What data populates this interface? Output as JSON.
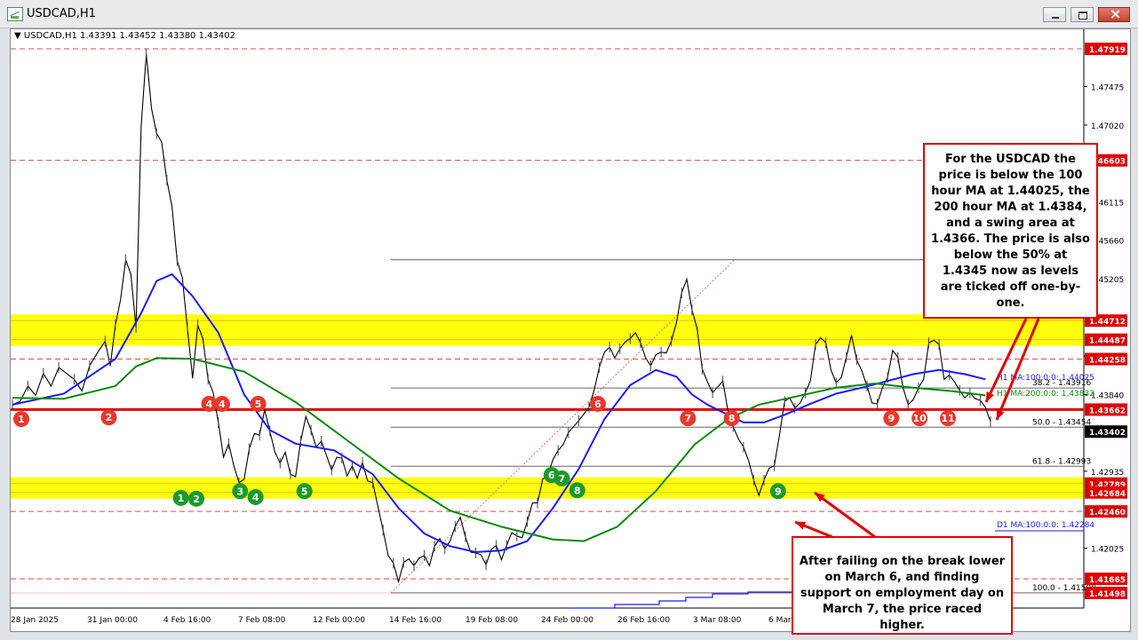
{
  "window": {
    "title": "USDCAD,H1",
    "controls": {
      "minimize": "minimize",
      "maximize": "maximize",
      "close": "close"
    }
  },
  "chart_header": {
    "symbol_line": "USDCAD,H1  1.43391 1.43452 1.43380 1.43402"
  },
  "colors": {
    "candles": "#000000",
    "ma100": "#1a1aff",
    "ma200": "#0a8a0a",
    "highlight": "#ffff00",
    "swing_line": "#e00000",
    "labels_red": "#e8382c",
    "labels_green": "#1c9a2a"
  },
  "chart_data": {
    "type": "line",
    "symbol": "USDCAD",
    "timeframe": "H1",
    "ohlc_last": {
      "open": 1.43391,
      "high": 1.43452,
      "low": 1.4338,
      "close": 1.43402
    },
    "x_axis_labels": [
      "28 Jan 2025",
      "31 Jan 00:00",
      "4 Feb 16:00",
      "7 Feb 08:00",
      "12 Feb 00:00",
      "14 Feb 16:00",
      "19 Feb 08:00",
      "24 Feb 00:00",
      "26 Feb 16:00",
      "3 Mar 08:00",
      "6 Mar"
    ],
    "y_axis_labels": [
      "1.47475",
      "1.47020",
      "1.46115",
      "1.45660",
      "1.45205",
      "1.44750",
      "1.44295",
      "1.43840",
      "1.42935",
      "1.42025"
    ],
    "y_range": [
      1.4132,
      1.4815
    ],
    "price_markers": [
      {
        "label": "1.47919",
        "value": 1.47919,
        "dashed": true
      },
      {
        "label": "1.46603",
        "value": 1.46603,
        "dashed": true
      },
      {
        "label": "1.44712",
        "value": 1.44712,
        "dashed": false
      },
      {
        "label": "1.44487",
        "value": 1.44487,
        "dashed": false
      },
      {
        "label": "1.44258",
        "value": 1.44258,
        "dashed": true
      },
      {
        "label": "1.43662",
        "value": 1.43662,
        "dashed": false
      },
      {
        "label": "1.43402",
        "value": 1.43402,
        "dashed": false
      },
      {
        "label": "1.42789",
        "value": 1.42789,
        "dashed": false
      },
      {
        "label": "1.42684",
        "value": 1.42684,
        "dashed": false
      },
      {
        "label": "1.42460",
        "value": 1.4246,
        "dashed": true
      },
      {
        "label": "1.41665",
        "value": 1.41665,
        "dashed": true
      },
      {
        "label": "1.41498",
        "value": 1.41498,
        "dashed": false
      }
    ],
    "fib_levels": [
      {
        "label": "38.2 - 1.43916",
        "value": 1.43916
      },
      {
        "label": "50.0 - 1.43454",
        "value": 1.43454
      },
      {
        "label": "61.8 - 1.42993",
        "value": 1.42993
      },
      {
        "label": "100.0 - 1.41500",
        "value": 1.415
      }
    ],
    "ma_labels": [
      {
        "label": "H1 MA:100:0:0: 1.44025",
        "value": 1.44025
      },
      {
        "label": "H1 MA:200:0:0: 1.43832",
        "value": 1.43832
      },
      {
        "label": "D1 MA:100:0:0: 1.42284",
        "value": 1.42284
      }
    ],
    "zones": [
      {
        "from": 1.44487,
        "to": 1.44712
      },
      {
        "from": 1.42684,
        "to": 1.42789
      }
    ],
    "price_series": [
      [
        0,
        1.4372
      ],
      [
        3,
        1.4376
      ],
      [
        6,
        1.4394
      ],
      [
        9,
        1.4383
      ],
      [
        12,
        1.4409
      ],
      [
        15,
        1.4394
      ],
      [
        18,
        1.4416
      ],
      [
        21,
        1.4409
      ],
      [
        24,
        1.4402
      ],
      [
        27,
        1.4388
      ],
      [
        30,
        1.4418
      ],
      [
        33,
        1.4433
      ],
      [
        36,
        1.4447
      ],
      [
        38,
        1.4418
      ],
      [
        40,
        1.4466
      ],
      [
        42,
        1.4496
      ],
      [
        44,
        1.4543
      ],
      [
        46,
        1.4526
      ],
      [
        48,
        1.4463
      ],
      [
        50,
        1.4701
      ],
      [
        52,
        1.4786
      ],
      [
        54,
        1.4722
      ],
      [
        56,
        1.4692
      ],
      [
        58,
        1.4682
      ],
      [
        60,
        1.4637
      ],
      [
        62,
        1.4606
      ],
      [
        64,
        1.4542
      ],
      [
        66,
        1.4522
      ],
      [
        68,
        1.4462
      ],
      [
        70,
        1.4403
      ],
      [
        72,
        1.4466
      ],
      [
        74,
        1.445
      ],
      [
        76,
        1.4402
      ],
      [
        78,
        1.4386
      ],
      [
        80,
        1.4351
      ],
      [
        82,
        1.431
      ],
      [
        84,
        1.4326
      ],
      [
        86,
        1.43
      ],
      [
        88,
        1.428
      ],
      [
        90,
        1.4284
      ],
      [
        92,
        1.432
      ],
      [
        94,
        1.4338
      ],
      [
        96,
        1.4336
      ],
      [
        98,
        1.4366
      ],
      [
        100,
        1.4341
      ],
      [
        102,
        1.4316
      ],
      [
        104,
        1.4303
      ],
      [
        106,
        1.4316
      ],
      [
        108,
        1.429
      ],
      [
        110,
        1.4287
      ],
      [
        112,
        1.4329
      ],
      [
        114,
        1.4358
      ],
      [
        116,
        1.4342
      ],
      [
        118,
        1.4322
      ],
      [
        120,
        1.4329
      ],
      [
        122,
        1.4312
      ],
      [
        124,
        1.4295
      ],
      [
        126,
        1.431
      ],
      [
        128,
        1.4309
      ],
      [
        130,
        1.4288
      ],
      [
        132,
        1.43
      ],
      [
        134,
        1.4285
      ],
      [
        136,
        1.4304
      ],
      [
        138,
        1.4282
      ],
      [
        140,
        1.428
      ],
      [
        142,
        1.4252
      ],
      [
        144,
        1.4224
      ],
      [
        146,
        1.4194
      ],
      [
        148,
        1.4185
      ],
      [
        150,
        1.4163
      ],
      [
        152,
        1.4186
      ],
      [
        154,
        1.419
      ],
      [
        156,
        1.4182
      ],
      [
        158,
        1.4191
      ],
      [
        160,
        1.4194
      ],
      [
        162,
        1.4182
      ],
      [
        164,
        1.4205
      ],
      [
        166,
        1.4214
      ],
      [
        168,
        1.4202
      ],
      [
        170,
        1.4211
      ],
      [
        172,
        1.4228
      ],
      [
        174,
        1.4239
      ],
      [
        176,
        1.4216
      ],
      [
        178,
        1.4198
      ],
      [
        180,
        1.4197
      ],
      [
        182,
        1.4195
      ],
      [
        184,
        1.4183
      ],
      [
        186,
        1.4201
      ],
      [
        188,
        1.4206
      ],
      [
        190,
        1.4189
      ],
      [
        192,
        1.4206
      ],
      [
        194,
        1.4221
      ],
      [
        196,
        1.4217
      ],
      [
        198,
        1.4215
      ],
      [
        200,
        1.4234
      ],
      [
        202,
        1.4256
      ],
      [
        204,
        1.4256
      ],
      [
        206,
        1.4284
      ],
      [
        208,
        1.4289
      ],
      [
        210,
        1.4307
      ],
      [
        212,
        1.4318
      ],
      [
        214,
        1.4325
      ],
      [
        216,
        1.4339
      ],
      [
        218,
        1.4346
      ],
      [
        220,
        1.4353
      ],
      [
        222,
        1.4361
      ],
      [
        224,
        1.4369
      ],
      [
        226,
        1.4389
      ],
      [
        228,
        1.4416
      ],
      [
        230,
        1.4434
      ],
      [
        232,
        1.444
      ],
      [
        234,
        1.4427
      ],
      [
        236,
        1.4438
      ],
      [
        238,
        1.4446
      ],
      [
        240,
        1.445
      ],
      [
        242,
        1.4457
      ],
      [
        244,
        1.4445
      ],
      [
        246,
        1.4427
      ],
      [
        248,
        1.4418
      ],
      [
        250,
        1.4431
      ],
      [
        252,
        1.4434
      ],
      [
        254,
        1.4433
      ],
      [
        256,
        1.4447
      ],
      [
        258,
        1.4469
      ],
      [
        260,
        1.4504
      ],
      [
        262,
        1.452
      ],
      [
        264,
        1.4484
      ],
      [
        266,
        1.4462
      ],
      [
        268,
        1.4414
      ],
      [
        270,
        1.4399
      ],
      [
        272,
        1.4386
      ],
      [
        274,
        1.4393
      ],
      [
        276,
        1.44
      ],
      [
        278,
        1.4364
      ],
      [
        280,
        1.4346
      ],
      [
        282,
        1.4332
      ],
      [
        284,
        1.4322
      ],
      [
        286,
        1.4306
      ],
      [
        288,
        1.4283
      ],
      [
        290,
        1.4265
      ],
      [
        292,
        1.4283
      ],
      [
        294,
        1.4297
      ],
      [
        296,
        1.43
      ],
      [
        298,
        1.4336
      ],
      [
        300,
        1.4376
      ],
      [
        302,
        1.438
      ],
      [
        304,
        1.4368
      ],
      [
        306,
        1.4374
      ],
      [
        308,
        1.4386
      ],
      [
        310,
        1.44
      ],
      [
        312,
        1.4443
      ],
      [
        314,
        1.4451
      ],
      [
        316,
        1.4445
      ],
      [
        318,
        1.4413
      ],
      [
        320,
        1.4398
      ],
      [
        322,
        1.4404
      ],
      [
        324,
        1.4428
      ],
      [
        326,
        1.4454
      ],
      [
        328,
        1.4425
      ],
      [
        330,
        1.4412
      ],
      [
        332,
        1.4394
      ],
      [
        334,
        1.4374
      ],
      [
        336,
        1.4373
      ],
      [
        338,
        1.4392
      ],
      [
        340,
        1.4404
      ],
      [
        342,
        1.4436
      ],
      [
        344,
        1.4428
      ],
      [
        346,
        1.4392
      ],
      [
        348,
        1.4372
      ],
      [
        350,
        1.4378
      ],
      [
        352,
        1.4392
      ],
      [
        354,
        1.4402
      ],
      [
        356,
        1.4445
      ],
      [
        358,
        1.4448
      ],
      [
        360,
        1.4443
      ],
      [
        362,
        1.4402
      ],
      [
        364,
        1.4407
      ],
      [
        366,
        1.4399
      ],
      [
        368,
        1.4389
      ],
      [
        370,
        1.438
      ],
      [
        372,
        1.4386
      ],
      [
        374,
        1.4379
      ],
      [
        376,
        1.4377
      ],
      [
        378,
        1.4369
      ],
      [
        380,
        1.4352
      ]
    ],
    "ma100_series": [
      [
        0,
        1.4372
      ],
      [
        20,
        1.4385
      ],
      [
        40,
        1.4426
      ],
      [
        50,
        1.448
      ],
      [
        56,
        1.4518
      ],
      [
        62,
        1.4526
      ],
      [
        70,
        1.45
      ],
      [
        80,
        1.4457
      ],
      [
        90,
        1.4384
      ],
      [
        100,
        1.4342
      ],
      [
        110,
        1.4326
      ],
      [
        125,
        1.4318
      ],
      [
        140,
        1.429
      ],
      [
        150,
        1.425
      ],
      [
        160,
        1.422
      ],
      [
        170,
        1.4205
      ],
      [
        180,
        1.4198
      ],
      [
        190,
        1.42
      ],
      [
        200,
        1.4211
      ],
      [
        210,
        1.425
      ],
      [
        220,
        1.4296
      ],
      [
        230,
        1.4355
      ],
      [
        240,
        1.4395
      ],
      [
        250,
        1.4413
      ],
      [
        258,
        1.4405
      ],
      [
        264,
        1.4384
      ],
      [
        270,
        1.4372
      ],
      [
        278,
        1.436
      ],
      [
        284,
        1.4351
      ],
      [
        292,
        1.4351
      ],
      [
        300,
        1.436
      ],
      [
        310,
        1.4373
      ],
      [
        320,
        1.4385
      ],
      [
        330,
        1.4392
      ],
      [
        340,
        1.44
      ],
      [
        350,
        1.4408
      ],
      [
        360,
        1.4413
      ],
      [
        370,
        1.4408
      ],
      [
        378,
        1.4402
      ]
    ],
    "ma200_series": [
      [
        0,
        1.438
      ],
      [
        20,
        1.4379
      ],
      [
        40,
        1.4394
      ],
      [
        48,
        1.4417
      ],
      [
        56,
        1.4427
      ],
      [
        70,
        1.4426
      ],
      [
        90,
        1.4411
      ],
      [
        110,
        1.4375
      ],
      [
        130,
        1.433
      ],
      [
        150,
        1.4285
      ],
      [
        170,
        1.4247
      ],
      [
        190,
        1.4228
      ],
      [
        210,
        1.4213
      ],
      [
        222,
        1.4211
      ],
      [
        235,
        1.4228
      ],
      [
        250,
        1.427
      ],
      [
        265,
        1.4325
      ],
      [
        278,
        1.4355
      ],
      [
        290,
        1.4372
      ],
      [
        305,
        1.4382
      ],
      [
        320,
        1.4392
      ],
      [
        335,
        1.4397
      ],
      [
        350,
        1.4392
      ],
      [
        365,
        1.4388
      ],
      [
        378,
        1.4383
      ]
    ],
    "event_labels_red": [
      {
        "text": "1",
        "x": 0,
        "y": 1.4355
      },
      {
        "text": "2",
        "x": 34,
        "y": 1.4357
      },
      {
        "text": "4",
        "x": 73,
        "y": 1.4373
      },
      {
        "text": "4",
        "x": 78,
        "y": 1.4373
      },
      {
        "text": "5",
        "x": 92,
        "y": 1.4373
      },
      {
        "text": "6",
        "x": 224,
        "y": 1.4373
      },
      {
        "text": "7",
        "x": 259,
        "y": 1.4356
      },
      {
        "text": "8",
        "x": 276,
        "y": 1.4356
      },
      {
        "text": "9",
        "x": 338,
        "y": 1.4356
      },
      {
        "text": "10",
        "x": 349,
        "y": 1.4356
      },
      {
        "text": "11",
        "x": 360,
        "y": 1.4356
      }
    ],
    "event_labels_green": [
      {
        "text": "1",
        "x": 62,
        "y": 1.4262
      },
      {
        "text": "2",
        "x": 68,
        "y": 1.4261
      },
      {
        "text": "3",
        "x": 85,
        "y": 1.427
      },
      {
        "text": "4",
        "x": 91,
        "y": 1.4263
      },
      {
        "text": "5",
        "x": 110,
        "y": 1.427
      },
      {
        "text": "6",
        "x": 206,
        "y": 1.4289
      },
      {
        "text": "7",
        "x": 210,
        "y": 1.4285
      },
      {
        "text": "8",
        "x": 216,
        "y": 1.4271
      },
      {
        "text": "9",
        "x": 294,
        "y": 1.427
      }
    ]
  },
  "annotations": {
    "top_box": "For the USDCAD the price is below the 100 hour MA at 1.44025, the 200 hour MA at 1.4384, and a swing area at 1.4366. The price is also below the 50% at 1.4345 now as levels are ticked off one-by-one.",
    "bottom_box": "After failing on the break lower on March 6, and finding support on employment day on March 7, the price raced higher."
  }
}
